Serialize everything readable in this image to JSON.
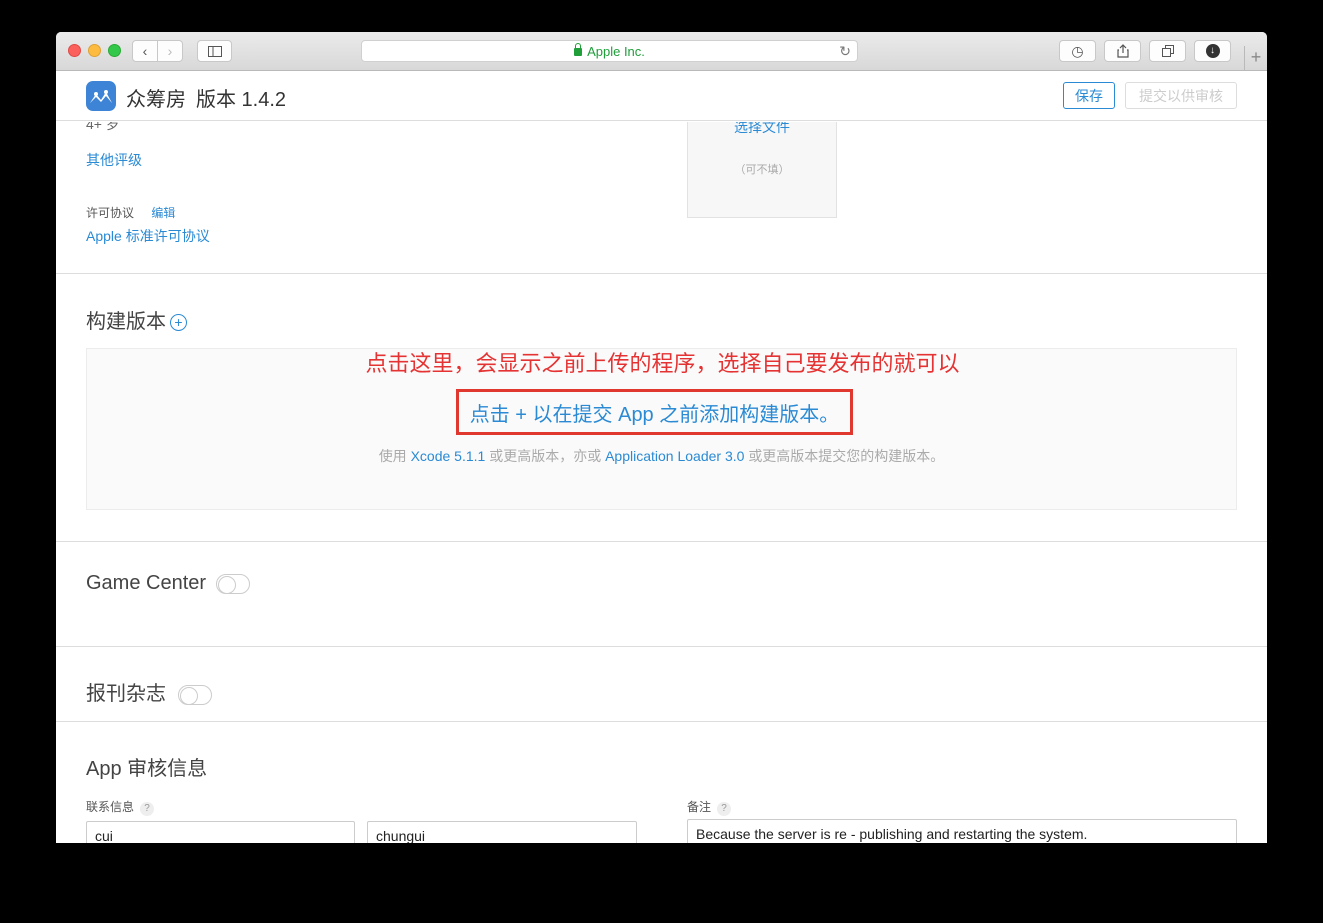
{
  "browser": {
    "address": "Apple Inc."
  },
  "header": {
    "app_name": "众筹房",
    "version": "版本 1.4.2",
    "save_label": "保存",
    "submit_label": "提交以供审核"
  },
  "rating": {
    "age": "4+ 岁",
    "other_ratings": "其他评级"
  },
  "license": {
    "label": "许可协议",
    "edit": "编辑",
    "link": "Apple 标准许可协议"
  },
  "file_upload": {
    "choose": "选择文件",
    "optional": "（可不填）"
  },
  "build": {
    "title": "构建版本",
    "annotation": "点击这里，会显示之前上传的程序，选择自己要发布的就可以",
    "add_prompt": "点击 + 以在提交 App 之前添加构建版本。",
    "hint_prefix": "使用",
    "hint_xcode": "Xcode 5.1.1",
    "hint_middle": "或更高版本，亦或",
    "hint_loader": "Application Loader 3.0",
    "hint_suffix": "或更高版本提交您的构建版本。"
  },
  "game_center": {
    "title": "Game Center",
    "enabled": false
  },
  "newsstand": {
    "title": "报刊杂志",
    "enabled": false
  },
  "review": {
    "title": "App 审核信息",
    "contact_label": "联系信息",
    "first_name": "cui",
    "last_name": "chungui",
    "notes_label": "备注",
    "notes_value": "Because the server is re - publishing and restarting the system."
  },
  "colors": {
    "link": "#2a8ad4",
    "annotation": "#e53333",
    "highlight_box": "#e0382f"
  }
}
